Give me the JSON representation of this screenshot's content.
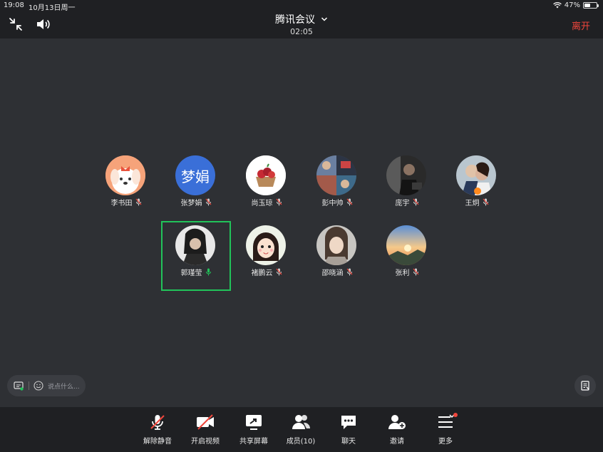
{
  "status": {
    "time": "19:08",
    "date": "10月13日周一",
    "battery": "47%",
    "battery_level": 0.47
  },
  "header": {
    "title": "腾讯会议",
    "timer": "02:05",
    "leave_label": "离开"
  },
  "members": [
    {
      "name": "李书田",
      "avatar": "cartoon-dog",
      "muted": true
    },
    {
      "name": "张梦娟",
      "avatar_text": "梦娟",
      "muted": true
    },
    {
      "name": "尚玉琼",
      "avatar": "fruit-basket",
      "muted": true
    },
    {
      "name": "彭中帅",
      "avatar": "photo-collage",
      "muted": true
    },
    {
      "name": "庞宇",
      "avatar": "photo-dark",
      "muted": true
    },
    {
      "name": "王炯",
      "avatar": "photo-couple",
      "muted": true,
      "host": true
    },
    {
      "name": "郭瑾莹",
      "avatar": "photo-girl",
      "muted": false,
      "active": true
    },
    {
      "name": "褚鹏云",
      "avatar": "cartoon-girl",
      "muted": true
    },
    {
      "name": "邵晓涵",
      "avatar": "photo-portrait",
      "muted": true
    },
    {
      "name": "张利",
      "avatar": "photo-sunset",
      "muted": true
    }
  ],
  "chat": {
    "placeholder": "说点什么..."
  },
  "toolbar": {
    "unmute": "解除静音",
    "video": "开启视频",
    "share": "共享屏幕",
    "members": "成员(10)",
    "chat": "聊天",
    "invite": "邀请",
    "more": "更多"
  },
  "colors": {
    "accent_green": "#21c35a",
    "leave_red": "#f0463c",
    "avatar_blue": "#3a6fd8"
  }
}
